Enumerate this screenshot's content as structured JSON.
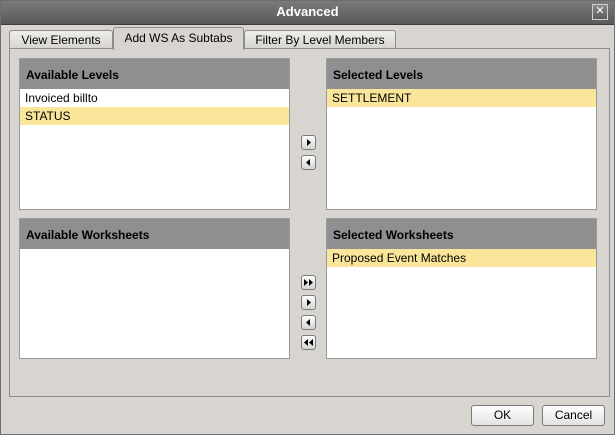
{
  "window": {
    "title": "Advanced",
    "close_icon": "close-icon"
  },
  "tabs": [
    {
      "label": "View Elements",
      "active": false
    },
    {
      "label": "Add WS As Subtabs",
      "active": true
    },
    {
      "label": "Filter By Level Members",
      "active": false
    }
  ],
  "levels": {
    "available": {
      "header": "Available Levels",
      "items": [
        {
          "label": "Invoiced billto",
          "selected": false
        },
        {
          "label": "STATUS",
          "selected": true
        }
      ]
    },
    "selected": {
      "header": "Selected Levels",
      "items": [
        {
          "label": "SETTLEMENT",
          "selected": true
        }
      ]
    },
    "buttons": {
      "add_icon": "arrow-right-icon",
      "remove_icon": "arrow-left-icon"
    }
  },
  "worksheets": {
    "available": {
      "header": "Available Worksheets",
      "items": []
    },
    "selected": {
      "header": "Selected Worksheets",
      "items": [
        {
          "label": "Proposed Event Matches",
          "selected": true
        }
      ]
    },
    "buttons": {
      "add_all_icon": "double-arrow-right-icon",
      "add_icon": "arrow-right-icon",
      "remove_icon": "arrow-left-icon",
      "remove_all_icon": "double-arrow-left-icon"
    }
  },
  "footer": {
    "ok_label": "OK",
    "cancel_label": "Cancel"
  },
  "colors": {
    "selection": "#fae69a",
    "header_bg": "#8f8f8f",
    "titlebar": "#6a6a6a"
  }
}
